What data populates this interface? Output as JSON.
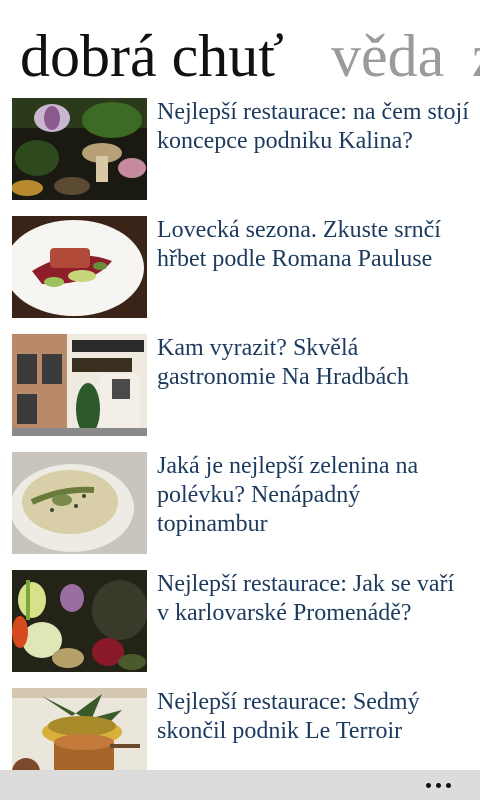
{
  "pivot": {
    "active": "dobrá chuť",
    "next": "věda",
    "peek": "z"
  },
  "articles": [
    {
      "headline": "Nejlepší restaurace: na čem stojí koncepce podniku Kalina?",
      "image": "vegetables-image"
    },
    {
      "headline": "Lovecká sezona. Zkuste srnčí hřbet podle Romana Pauluse",
      "image": "venison-dish-image"
    },
    {
      "headline": "Kam vyrazit? Skvělá gastronomie Na Hradbách",
      "image": "restaurant-facade-image"
    },
    {
      "headline": "Jaká je nejlepší zelenina na polévku? Nenápadný topinambur",
      "image": "soup-bowl-image"
    },
    {
      "headline": "Nejlepší restaurace: Jak se vaří v karlovarské Promenádě?",
      "image": "vegetables-still-life-image"
    },
    {
      "headline": "Nejlepší restaurace: Sedmý skončil podnik Le Terroir",
      "image": "pineapple-dish-image"
    }
  ],
  "app_bar": {
    "more_icon": "ellipsis-icon",
    "background": "#dcdcdc"
  },
  "colors": {
    "headline": "#1c3a5e",
    "active_title": "#111111",
    "inactive_title": "#9b9b9b"
  }
}
